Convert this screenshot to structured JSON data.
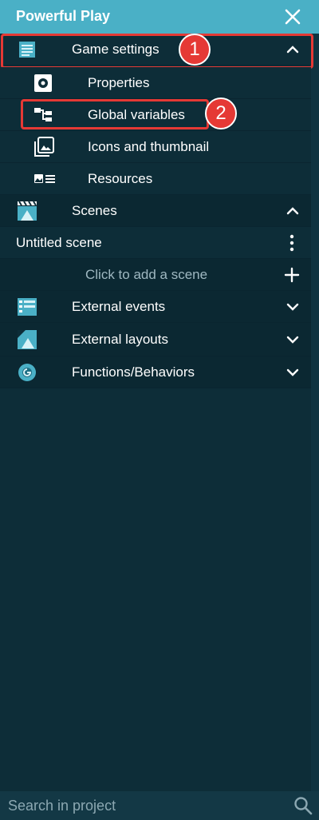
{
  "window": {
    "title": "Powerful Play"
  },
  "sections": {
    "game_settings": {
      "label": "Game settings",
      "badge": "1"
    },
    "properties": {
      "label": "Properties"
    },
    "global_variables": {
      "label": "Global variables",
      "badge": "2"
    },
    "icons_thumbnail": {
      "label": "Icons and thumbnail"
    },
    "resources": {
      "label": "Resources"
    },
    "scenes": {
      "label": "Scenes"
    },
    "untitled_scene": {
      "label": "Untitled scene"
    },
    "add_scene": {
      "label": "Click to add a scene"
    },
    "external_events": {
      "label": "External events"
    },
    "external_layouts": {
      "label": "External layouts"
    },
    "functions_behaviors": {
      "label": "Functions/Behaviors"
    }
  },
  "search": {
    "placeholder": "Search in project"
  },
  "colors": {
    "titlebar": "#4ab0c6",
    "background": "#0d2d38",
    "highlight": "#e53935"
  }
}
